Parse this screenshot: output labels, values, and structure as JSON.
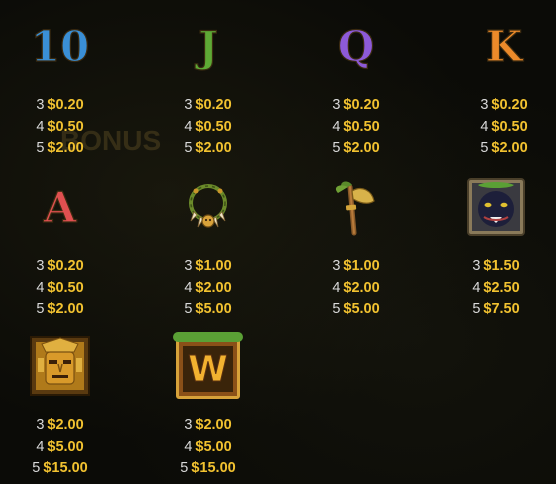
{
  "paytable": [
    {
      "symbol": "10",
      "kind": "letter",
      "color": "#3a8fd6",
      "pays": [
        {
          "count": "3",
          "value": "$0.20"
        },
        {
          "count": "4",
          "value": "$0.50"
        },
        {
          "count": "5",
          "value": "$2.00"
        }
      ]
    },
    {
      "symbol": "J",
      "kind": "letter",
      "color": "#5ea935",
      "pays": [
        {
          "count": "3",
          "value": "$0.20"
        },
        {
          "count": "4",
          "value": "$0.50"
        },
        {
          "count": "5",
          "value": "$2.00"
        }
      ]
    },
    {
      "symbol": "Q",
      "kind": "letter",
      "color": "#8d5ad8",
      "pays": [
        {
          "count": "3",
          "value": "$0.20"
        },
        {
          "count": "4",
          "value": "$0.50"
        },
        {
          "count": "5",
          "value": "$2.00"
        }
      ]
    },
    {
      "symbol": "K",
      "kind": "letter",
      "color": "#ec8a2a",
      "pays": [
        {
          "count": "3",
          "value": "$0.20"
        },
        {
          "count": "4",
          "value": "$0.50"
        },
        {
          "count": "5",
          "value": "$2.00"
        }
      ]
    },
    {
      "symbol": "A",
      "kind": "letter",
      "color": "#e05050",
      "pays": [
        {
          "count": "3",
          "value": "$0.20"
        },
        {
          "count": "4",
          "value": "$0.50"
        },
        {
          "count": "5",
          "value": "$2.00"
        }
      ]
    },
    {
      "symbol": "necklace",
      "kind": "icon",
      "icon": "necklace-icon",
      "pays": [
        {
          "count": "3",
          "value": "$1.00"
        },
        {
          "count": "4",
          "value": "$2.00"
        },
        {
          "count": "5",
          "value": "$5.00"
        }
      ]
    },
    {
      "symbol": "axe",
      "kind": "icon",
      "icon": "axe-icon",
      "pays": [
        {
          "count": "3",
          "value": "$1.00"
        },
        {
          "count": "4",
          "value": "$2.00"
        },
        {
          "count": "5",
          "value": "$5.00"
        }
      ]
    },
    {
      "symbol": "panther-mask",
      "kind": "icon",
      "icon": "panther-mask-icon",
      "pays": [
        {
          "count": "3",
          "value": "$1.50"
        },
        {
          "count": "4",
          "value": "$2.50"
        },
        {
          "count": "5",
          "value": "$7.50"
        }
      ]
    },
    {
      "symbol": "golden-mask",
      "kind": "icon",
      "icon": "golden-mask-icon",
      "pays": [
        {
          "count": "3",
          "value": "$2.00"
        },
        {
          "count": "4",
          "value": "$5.00"
        },
        {
          "count": "5",
          "value": "$15.00"
        }
      ]
    },
    {
      "symbol": "W",
      "kind": "wild",
      "icon": "wild-icon",
      "label": "W",
      "pays": [
        {
          "count": "3",
          "value": "$2.00"
        },
        {
          "count": "4",
          "value": "$5.00"
        },
        {
          "count": "5",
          "value": "$15.00"
        }
      ]
    }
  ],
  "background": {
    "ghost_text": "BONUS"
  }
}
